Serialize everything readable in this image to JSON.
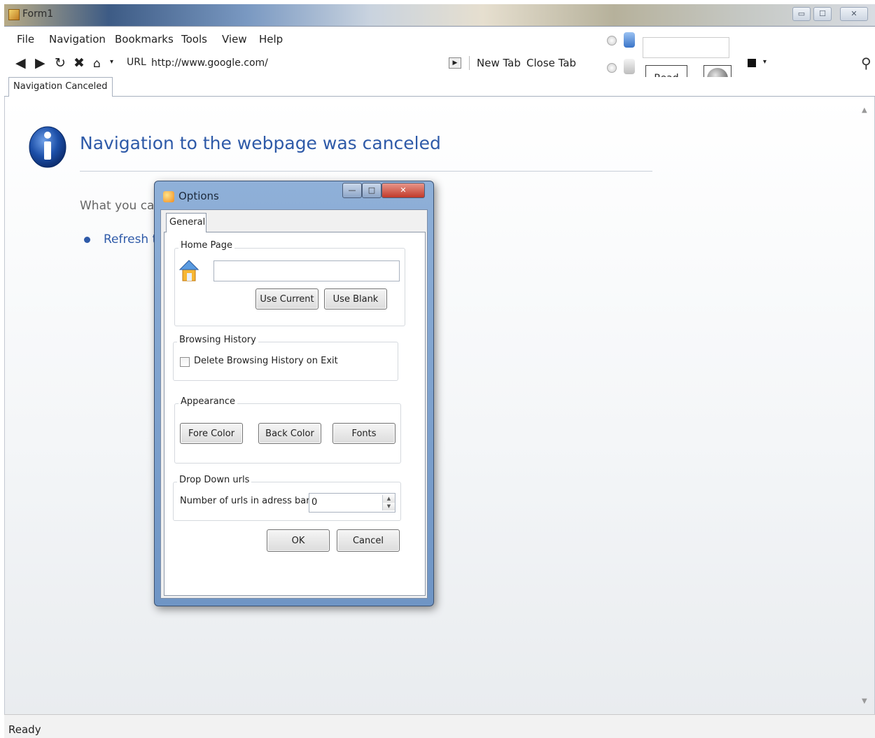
{
  "window": {
    "title": "Form1",
    "controls": [
      "▭",
      "☐",
      "✕"
    ]
  },
  "menu": [
    "File",
    "Navigation",
    "Bookmarks",
    "Tools",
    "View",
    "Help"
  ],
  "toolbar": {
    "url_label": "URL",
    "url_value": "http://www.google.com/",
    "new_tab": "New Tab",
    "close_tab": "Close Tab",
    "read_button": "Read"
  },
  "tab": {
    "label": "Navigation Canceled"
  },
  "page": {
    "title": "Navigation to the webpage was canceled",
    "subtitle": "What you can",
    "link": "Refresh th"
  },
  "status": {
    "text": "Ready"
  },
  "dialog": {
    "title": "Options",
    "tab": "General",
    "home_page": {
      "label": "Home Page",
      "value": "",
      "use_current": "Use Current",
      "use_blank": "Use Blank"
    },
    "browsing_history": {
      "label": "Browsing History",
      "checkbox_label": "Delete Browsing History on Exit",
      "checked": false
    },
    "appearance": {
      "label": "Appearance",
      "fore_color": "Fore Color",
      "back_color": "Back Color",
      "fonts": "Fonts"
    },
    "drop_down_urls": {
      "label": "Drop Down urls",
      "field_label": "Number of urls in adress bar",
      "value": "0"
    },
    "ok": "OK",
    "cancel": "Cancel"
  },
  "colors": {
    "link_blue": "#2e5aa8",
    "dialog_frame": "#8fb0d8",
    "close_red": "#c23a2a"
  },
  "icons": [
    "back-arrow-icon",
    "forward-arrow-icon",
    "refresh-icon",
    "stop-icon",
    "home-icon",
    "go-icon",
    "search-icon",
    "info-icon",
    "media-icon",
    "bookmark-icon"
  ]
}
